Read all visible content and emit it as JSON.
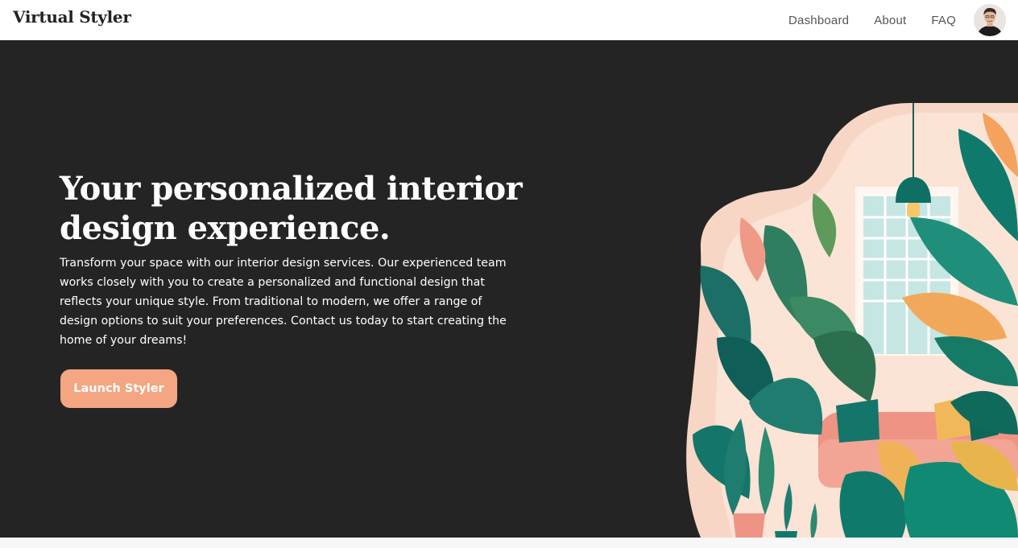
{
  "header": {
    "brand": "Virtual Styler",
    "nav": [
      {
        "label": "Dashboard"
      },
      {
        "label": "About"
      },
      {
        "label": "FAQ"
      }
    ],
    "avatar_icon": "user-avatar-icon"
  },
  "hero": {
    "title": "Your personalized interior design experience.",
    "description": "Transform your space with our interior design services. Our experienced team works closely with you to create a personalized and functional design that reflects your unique style. From traditional to modern, we offer a range of design options to suit your preferences. Contact us today to start creating the home of your dreams!",
    "cta_label": "Launch Styler",
    "illustration_icon": "interior-plants-illustration",
    "colors": {
      "background": "#242424",
      "accent": "#f4a582",
      "teal": "#0f7a6c",
      "coral": "#ef9384",
      "blush": "#f8d6c6"
    }
  }
}
